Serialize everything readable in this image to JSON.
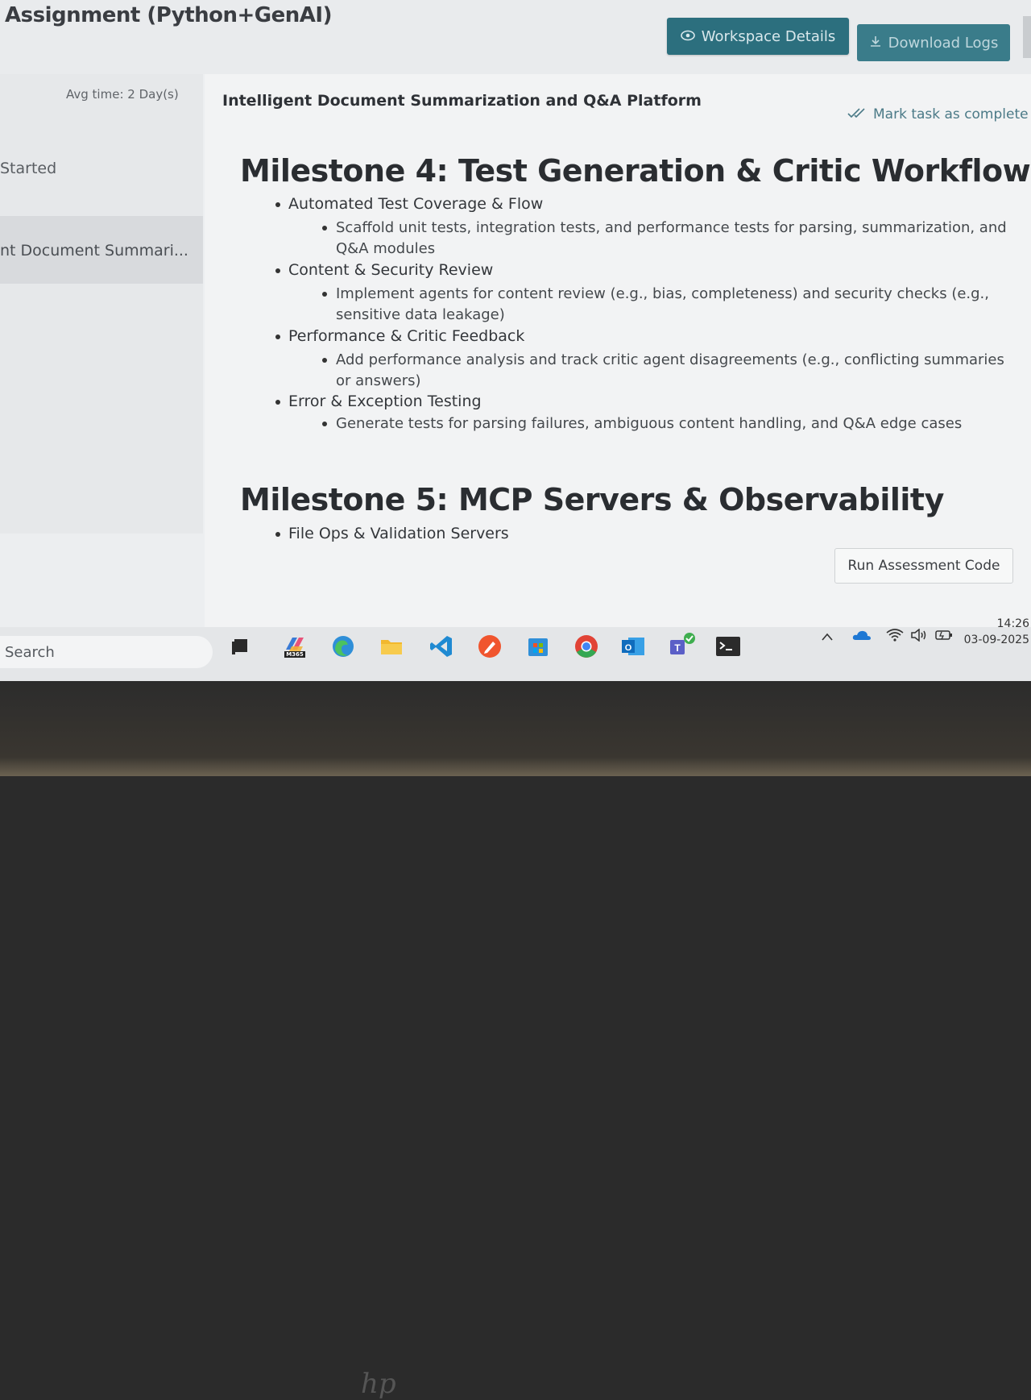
{
  "header": {
    "title": "Assignment (Python+GenAI)",
    "workspace_button": "Workspace Details",
    "download_button": "Download Logs"
  },
  "sidebar": {
    "avg_time": "Avg time: 2 Day(s)",
    "status": "Started",
    "selected_item": "nt Document Summari..."
  },
  "task": {
    "title": "Intelligent Document Summarization and Q&A Platform",
    "mark_complete": "Mark task as complete"
  },
  "milestones": [
    {
      "heading": "Milestone 4: Test Generation & Critic Workflow",
      "items": [
        {
          "title": "Automated Test Coverage & Flow",
          "detail": "Scaffold unit tests, integration tests, and performance tests for parsing, summarization, and Q&A modules"
        },
        {
          "title": "Content & Security Review",
          "detail": "Implement agents for content review (e.g., bias, completeness) and security checks (e.g., sensitive data leakage)"
        },
        {
          "title": "Performance & Critic Feedback",
          "detail": "Add performance analysis and track critic agent disagreements (e.g., conflicting summaries or answers)"
        },
        {
          "title": "Error & Exception Testing",
          "detail": "Generate tests for parsing failures, ambiguous content handling, and Q&A edge cases"
        }
      ]
    },
    {
      "heading": "Milestone 5: MCP Servers & Observability",
      "items": [
        {
          "title": "File Ops & Validation Servers"
        }
      ]
    }
  ],
  "run_button": "Run Assessment Code",
  "taskbar": {
    "search": "Search",
    "m365_label": "M365",
    "time": "14:26",
    "date": "03-09-2025"
  },
  "colors": {
    "accent": "#2c6f7e",
    "accent_light": "#3a7c8a"
  }
}
